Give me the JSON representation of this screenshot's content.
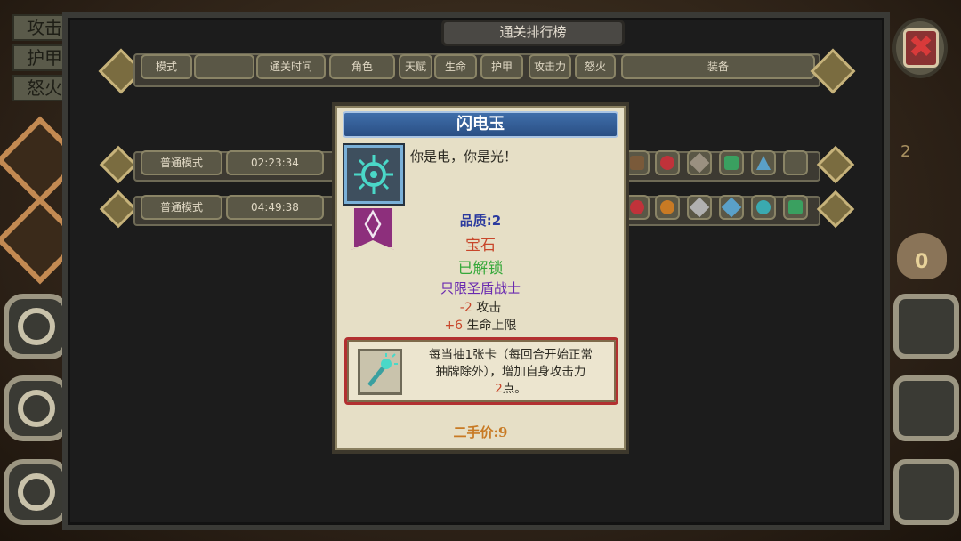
{
  "background": {
    "stat_labels": [
      "攻击",
      "护甲",
      "怒火"
    ],
    "bag_count": "0",
    "side_number": "2"
  },
  "leaderboard": {
    "title": "通关排行榜",
    "headers": [
      "模式",
      "通关时间",
      "角色",
      "天赋",
      "生命",
      "护甲",
      "攻击力",
      "怒火",
      "装备"
    ],
    "rows": [
      {
        "mode": "普通模式",
        "time": "02:23:34"
      },
      {
        "mode": "普通模式",
        "time": "04:49:38"
      }
    ]
  },
  "tooltip": {
    "name": "闪电玉",
    "quote": "你是电，你是光！",
    "quality": "品质:2",
    "type": "宝石",
    "status": "已解锁",
    "class": "只限圣盾战士",
    "stat1_value": "-2",
    "stat1_label": " 攻击",
    "stat2_value": "+6",
    "stat2_label": " 生命上限",
    "effect_line1": "每当抽1张卡（每回合开始正常",
    "effect_line2": "抽牌除外），增加自身攻击力",
    "effect_value": "2",
    "effect_tail": "点。",
    "price": "二手价:9"
  },
  "colors": {
    "banner": "#3f6eaa",
    "quality": "#2b3a9e",
    "type": "#c8462a",
    "unlocked": "#35a83a",
    "class": "#6a2ab0",
    "effect_border": "#b23030",
    "price": "#c87a24"
  },
  "icons": [
    "close-icon",
    "lightning-jade-icon",
    "class-banner-icon",
    "effect-wand-icon",
    "coin-bag-icon"
  ]
}
